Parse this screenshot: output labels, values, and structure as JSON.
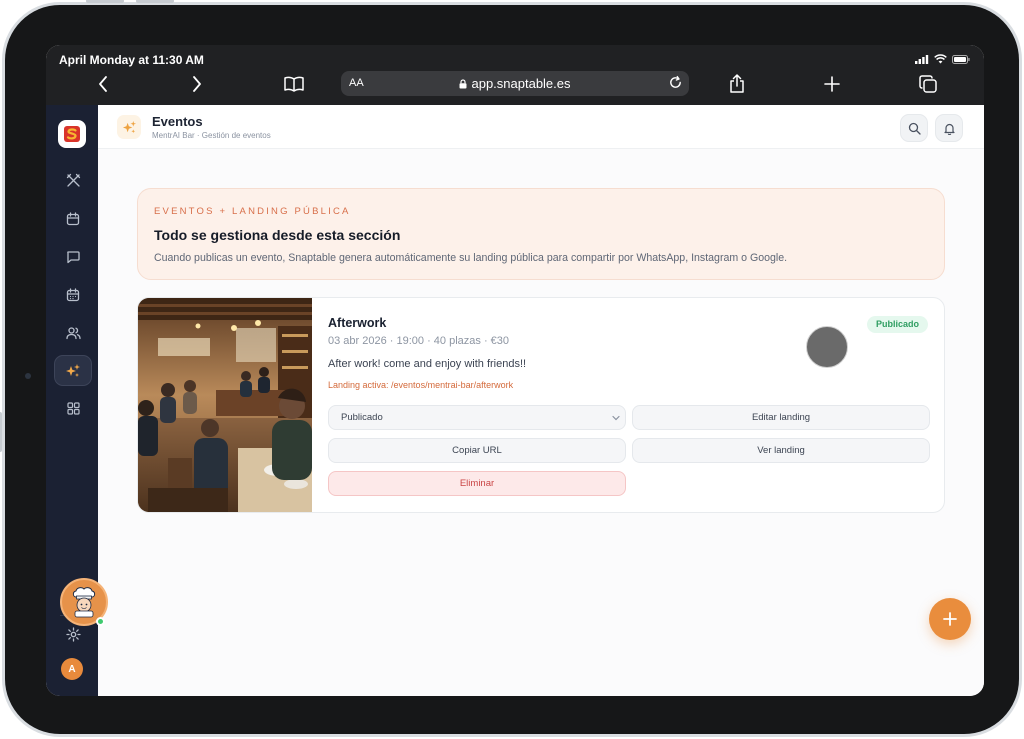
{
  "device": {
    "status_time": "April Monday at 11:30 AM"
  },
  "browser": {
    "reader_label": "AA",
    "url": "app.snaptable.es"
  },
  "sidebar": {
    "items": [
      {
        "icon": "utensils-icon"
      },
      {
        "icon": "calendar-icon"
      },
      {
        "icon": "chat-icon"
      },
      {
        "icon": "calendar-grid-icon"
      },
      {
        "icon": "users-icon"
      },
      {
        "icon": "sparkles-icon",
        "active": true
      },
      {
        "icon": "grid-icon"
      }
    ],
    "avatar_initial": "A"
  },
  "topbar": {
    "title": "Eventos",
    "subtitle": "MentrAI Bar · Gestión de eventos"
  },
  "banner": {
    "eyebrow": "EVENTOS + LANDING PÚBLICA",
    "heading": "Todo se gestiona desde esta sección",
    "description": "Cuando publicas un evento, Snaptable genera automáticamente su landing pública para compartir por WhatsApp, Instagram o Google."
  },
  "event": {
    "name": "Afterwork",
    "meta": "03 abr 2026 · 19:00 · 40 plazas · €30",
    "description": "After work! come and enjoy with friends!!",
    "landing": "Landing activa: /eventos/mentrai-bar/afterwork",
    "status_badge": "Publicado",
    "status_select": "Publicado",
    "buttons": {
      "edit_landing": "Editar landing",
      "copy_url": "Copiar URL",
      "view_landing": "Ver landing",
      "delete": "Eliminar"
    }
  },
  "colors": {
    "accent": "#e98d3d",
    "sidebar_bg": "#1b2133",
    "published_green": "#2f9e62",
    "danger": "#c94545"
  }
}
